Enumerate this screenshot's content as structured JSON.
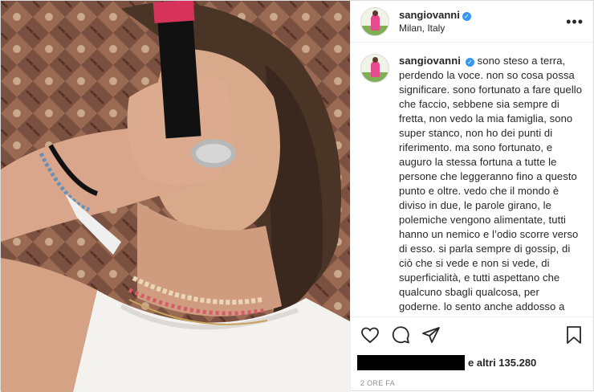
{
  "post": {
    "username": "sangiovanni",
    "location": "Milan, Italy",
    "more_icon": "more-options-icon",
    "caption": "sono steso a terra, perdendo la voce. non so cosa possa significare. sono fortunato a fare quello che faccio, sebbene sia sempre di fretta, non vedo la mia famiglia, sono super stanco, non ho dei punti di riferimento. ma sono fortunato, e auguro la stessa fortuna a tutte le persone che leggeranno fino a questo punto e oltre. vedo che il mondo è diviso in due, le parole girano, le polemiche vengono alimentate, tutti hanno un nemico e l’odio scorre verso di esso. si parla sempre di gossip, di ciò che si vede e non si vede, di superficialità, e tutti aspettano che qualcuno sbagli qualcosa, per goderne. lo sento anche addosso a me. ma voglio dirvi",
    "likes_text": "e altri 135.280",
    "timestamp": "2 ORE FA"
  },
  "icons": {
    "like": "heart-icon",
    "comment": "comment-icon",
    "share": "share-icon",
    "save": "bookmark-icon",
    "verified": "verified-badge-icon"
  },
  "colors": {
    "verified_blue": "#3897f0",
    "text": "#262626",
    "muted": "#8e8e8e"
  }
}
